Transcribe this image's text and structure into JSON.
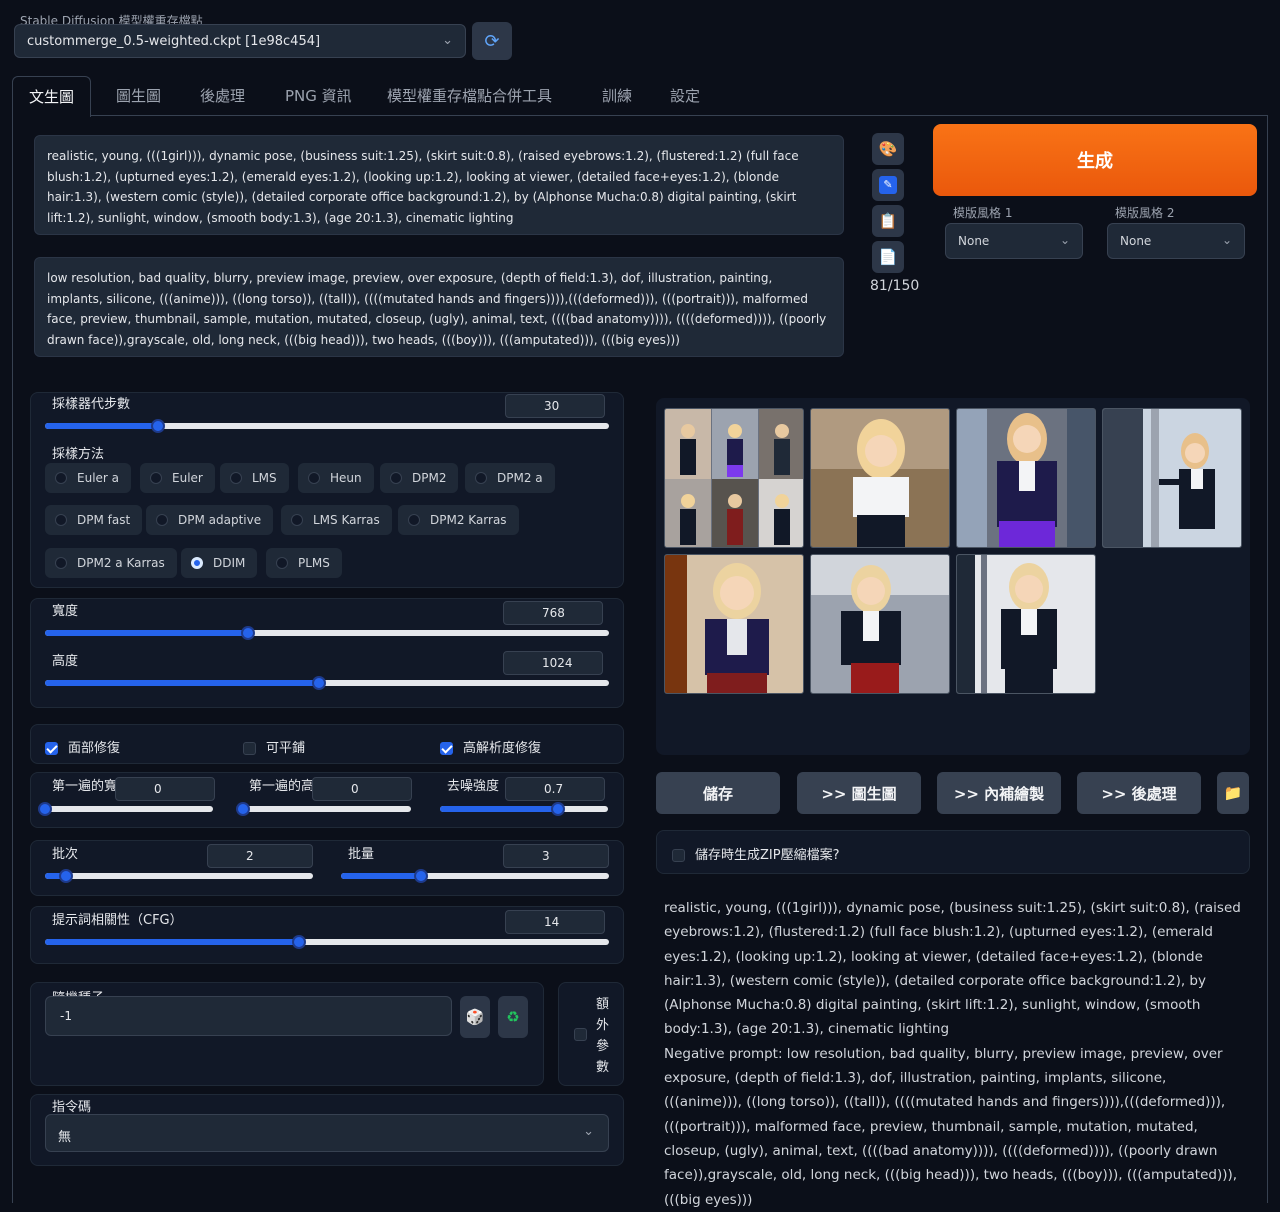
{
  "checkpoint": {
    "label": "Stable Diffusion 模型權重存檔點",
    "value": "custommerge_0.5-weighted.ckpt [1e98c454]"
  },
  "icons": {
    "refresh": "refresh-icon",
    "palette": "palette-icon",
    "edit": "edit-icon",
    "clipboard": "clipboard-icon",
    "document": "document-icon",
    "dice": "dice-icon",
    "recycle": "recycle-icon",
    "folder": "folder-icon",
    "chevron": "chevron-down-icon"
  },
  "tabs": [
    "文生圖",
    "圖生圖",
    "後處理",
    "PNG 資訊",
    "模型權重存檔點合併工具",
    "訓練",
    "設定"
  ],
  "prompt": "realistic, young, (((1girl))), dynamic pose, (business suit:1.25), (skirt suit:0.8), (raised eyebrows:1.2), (flustered:1.2) (full face blush:1.2), (upturned eyes:1.2), (emerald eyes:1.2), (looking up:1.2), looking at viewer, (detailed face+eyes:1.2), (blonde hair:1.3), (western comic (style)), (detailed corporate office background:1.2), by (Alphonse Mucha:0.8) digital painting, (skirt lift:1.2), sunlight, window, (smooth body:1.3), (age 20:1.3), cinematic lighting",
  "negative_prompt": "low resolution, bad quality, blurry, preview image, preview, over exposure, (depth of field:1.3), dof, illustration, painting, implants, silicone, (((anime))), ((long torso)), ((tall)), ((((mutated hands and fingers)))),(((deformed))), (((portrait))), malformed face, preview, thumbnail, sample, mutation, mutated, closeup, (ugly), animal, text, ((((bad anatomy)))), ((((deformed)))), ((poorly drawn face)),grayscale, old, long neck, (((big head))), two heads, (((boy))), (((amputated))), (((big eyes)))",
  "token_counter": "81/150",
  "generate_label": "生成",
  "styles": [
    {
      "label": "模版風格 1",
      "value": "None"
    },
    {
      "label": "模版風格 2",
      "value": "None"
    }
  ],
  "steps": {
    "label": "採樣器代步數",
    "value": "30",
    "fraction": 0.2
  },
  "sampler": {
    "label": "採樣方法",
    "options": [
      "Euler a",
      "Euler",
      "LMS",
      "Heun",
      "DPM2",
      "DPM2 a",
      "DPM fast",
      "DPM adaptive",
      "LMS Karras",
      "DPM2 Karras",
      "DPM2 a Karras",
      "DDIM",
      "PLMS"
    ],
    "selected": "DDIM"
  },
  "width": {
    "label": "寬度",
    "value": "768",
    "fraction": 0.36
  },
  "height": {
    "label": "高度",
    "value": "1024",
    "fraction": 0.485
  },
  "checkboxes": [
    {
      "label": "面部修復",
      "checked": true
    },
    {
      "label": "可平鋪",
      "checked": false
    },
    {
      "label": "高解析度修復",
      "checked": true
    }
  ],
  "firstpass_width": {
    "label": "第一遍的寬度",
    "value": "0",
    "fraction": 0.0
  },
  "firstpass_height": {
    "label": "第一遍的高度",
    "value": "0",
    "fraction": 0.0
  },
  "denoise": {
    "label": "去噪強度",
    "value": "0.7",
    "fraction": 0.7
  },
  "batch_count": {
    "label": "批次",
    "value": "2",
    "fraction": 0.08
  },
  "batch_size": {
    "label": "批量",
    "value": "3",
    "fraction": 0.3
  },
  "cfg": {
    "label": "提示詞相關性（CFG）",
    "value": "14",
    "fraction": 0.45
  },
  "seed": {
    "label": "隨機種子",
    "value": "-1"
  },
  "extra_label": "額外參數",
  "script": {
    "label": "指令碼",
    "value": "無"
  },
  "actions": [
    "儲存",
    ">> 圖生圖",
    ">> 內補繪製",
    ">> 後處理"
  ],
  "zip_label": "儲存時生成ZIP壓縮檔案?",
  "output_text": "realistic, young, (((1girl))), dynamic pose, (business suit:1.25), (skirt suit:0.8), (raised eyebrows:1.2), (flustered:1.2) (full face blush:1.2), (upturned eyes:1.2), (emerald eyes:1.2), (looking up:1.2), looking at viewer, (detailed face+eyes:1.2), (blonde hair:1.3), (western comic (style)), (detailed corporate office background:1.2), by (Alphonse Mucha:0.8) digital painting, (skirt lift:1.2), sunlight, window, (smooth body:1.3), (age 20:1.3), cinematic lighting",
  "output_negative": "Negative prompt: low resolution, bad quality, blurry, preview image, preview, over exposure, (depth of field:1.3), dof, illustration, painting, implants, silicone, (((anime))), ((long torso)), ((tall)), ((((mutated hands and fingers)))),(((deformed))), (((portrait))), malformed face, preview, thumbnail, sample, mutation, mutated, closeup, (ugly), animal, text, ((((bad anatomy)))), ((((deformed)))), ((poorly drawn face)),grayscale, old, long neck, (((big head))), two heads, (((boy))), (((amputated))), (((big eyes)))"
}
